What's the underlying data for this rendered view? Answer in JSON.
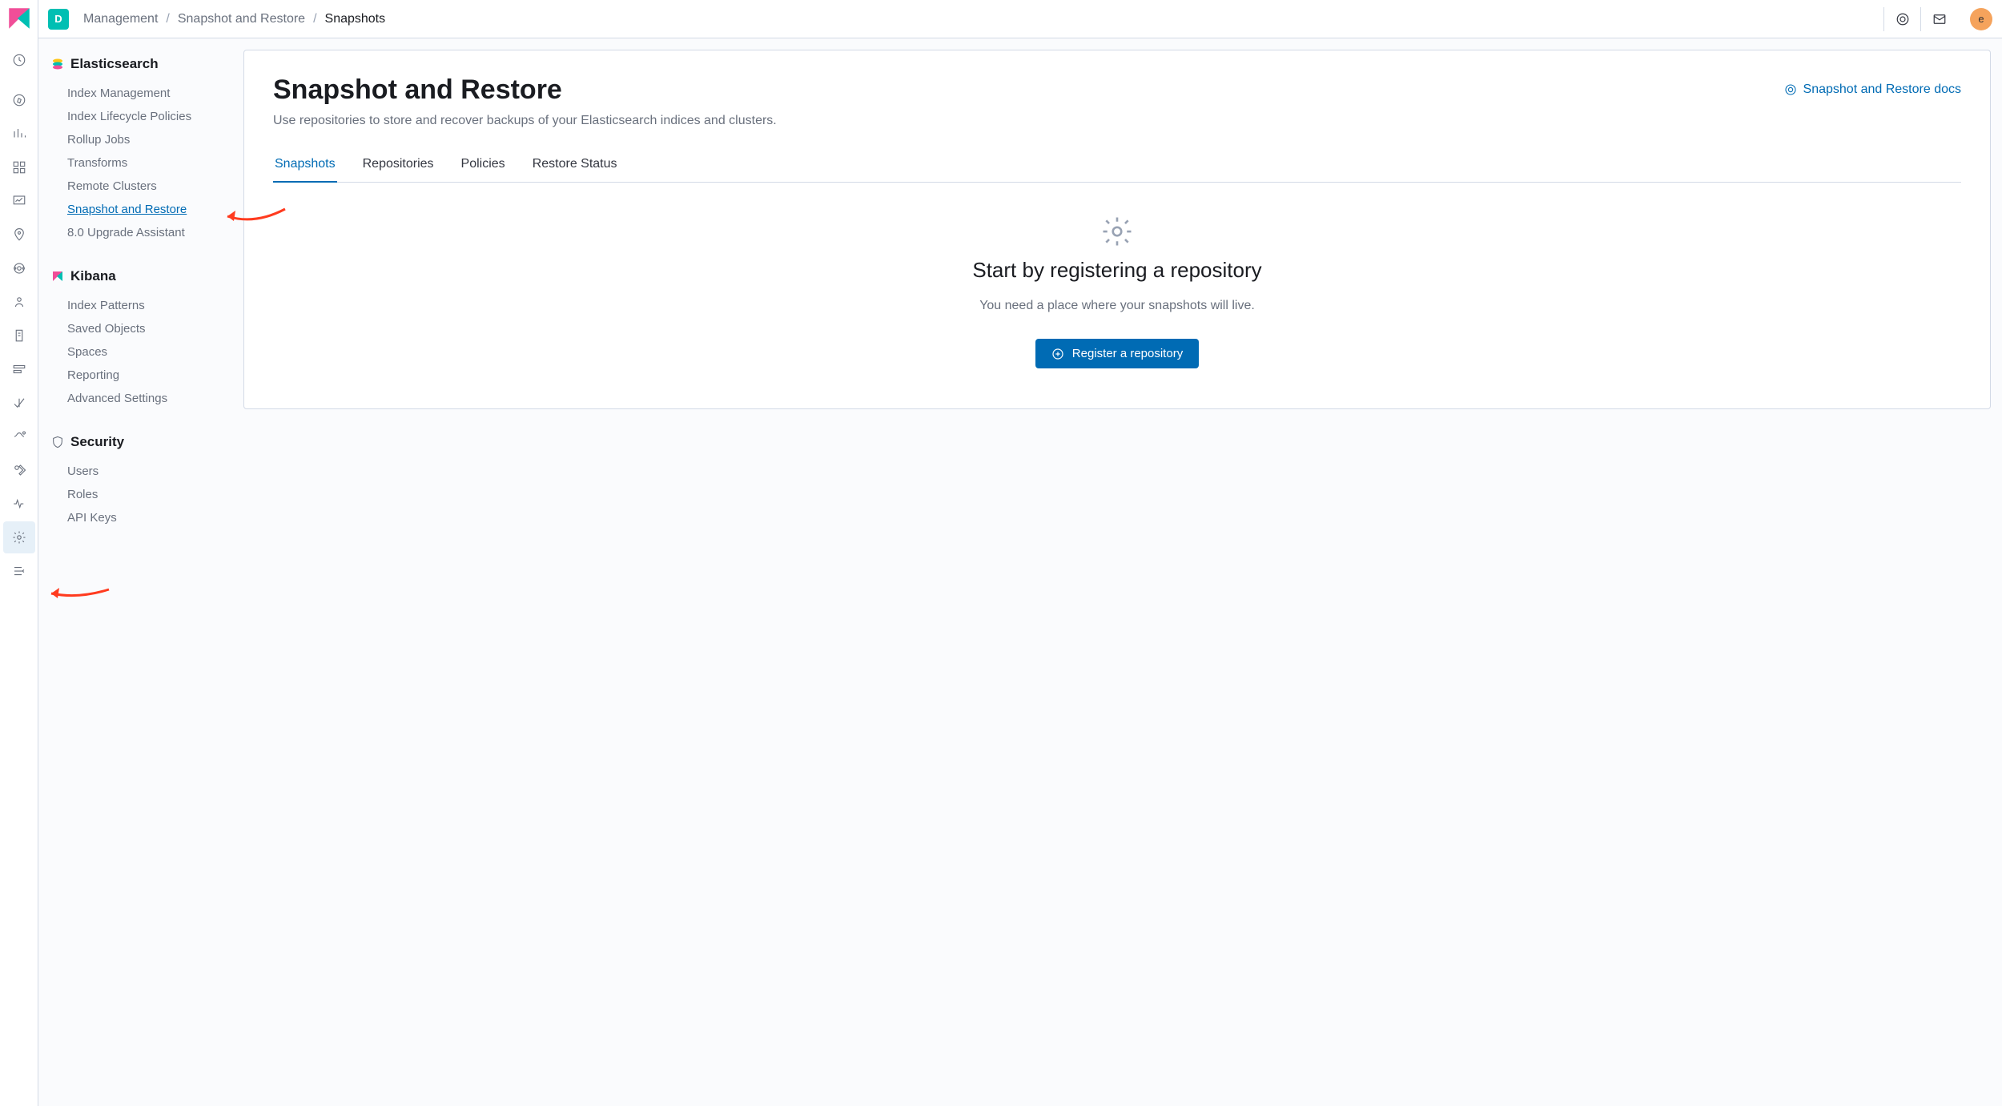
{
  "header": {
    "space_badge": "D",
    "breadcrumb": [
      "Management",
      "Snapshot and Restore",
      "Snapshots"
    ],
    "avatar_initial": "e"
  },
  "sidebar": {
    "sections": [
      {
        "title": "Elasticsearch",
        "icon": "elasticsearch-logo",
        "items": [
          {
            "label": "Index Management",
            "active": false
          },
          {
            "label": "Index Lifecycle Policies",
            "active": false
          },
          {
            "label": "Rollup Jobs",
            "active": false
          },
          {
            "label": "Transforms",
            "active": false
          },
          {
            "label": "Remote Clusters",
            "active": false
          },
          {
            "label": "Snapshot and Restore",
            "active": true
          },
          {
            "label": "8.0 Upgrade Assistant",
            "active": false
          }
        ]
      },
      {
        "title": "Kibana",
        "icon": "kibana-logo",
        "items": [
          {
            "label": "Index Patterns",
            "active": false
          },
          {
            "label": "Saved Objects",
            "active": false
          },
          {
            "label": "Spaces",
            "active": false
          },
          {
            "label": "Reporting",
            "active": false
          },
          {
            "label": "Advanced Settings",
            "active": false
          }
        ]
      },
      {
        "title": "Security",
        "icon": "shield-icon",
        "items": [
          {
            "label": "Users",
            "active": false
          },
          {
            "label": "Roles",
            "active": false
          },
          {
            "label": "API Keys",
            "active": false
          }
        ]
      }
    ]
  },
  "content": {
    "page_title": "Snapshot and Restore",
    "page_subtitle": "Use repositories to store and recover backups of your Elasticsearch indices and clusters.",
    "docs_link_label": "Snapshot and Restore docs",
    "tabs": [
      {
        "label": "Snapshots",
        "active": true
      },
      {
        "label": "Repositories",
        "active": false
      },
      {
        "label": "Policies",
        "active": false
      },
      {
        "label": "Restore Status",
        "active": false
      }
    ],
    "empty": {
      "title": "Start by registering a repository",
      "subtitle": "You need a place where your snapshots will live.",
      "button_label": "Register a repository"
    }
  }
}
